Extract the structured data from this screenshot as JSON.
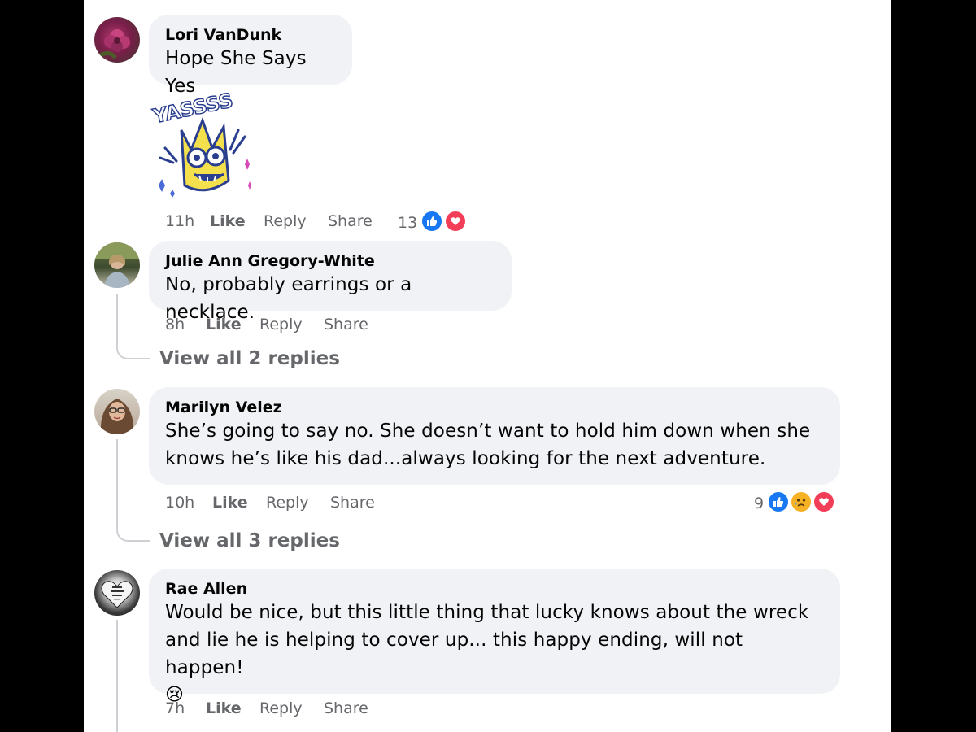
{
  "comments": [
    {
      "author": "Lori VanDunk",
      "text_lines": [
        "Hope She Says Yes"
      ],
      "sticker_text": "YASSSS",
      "time": "11h",
      "like": "Like",
      "reply": "Reply",
      "share": "Share",
      "reaction_count": "13",
      "reactions": [
        "like-icon",
        "love-icon"
      ]
    },
    {
      "author": "Julie Ann Gregory-White",
      "text_lines": [
        "No, probably earrings or a necklace."
      ],
      "time": "8h",
      "like": "Like",
      "reply": "Reply",
      "share": "Share",
      "view_replies": "View all 2 replies"
    },
    {
      "author": "Marilyn Velez",
      "text_lines": [
        "She’s going to say no. She doesn’t want to hold him down when she",
        "knows he’s like his dad...always looking for the next adventure."
      ],
      "time": "10h",
      "like": "Like",
      "reply": "Reply",
      "share": "Share",
      "reaction_count": "9",
      "reactions": [
        "like-icon",
        "sad-icon",
        "love-icon"
      ],
      "view_replies": "View all 3 replies"
    },
    {
      "author": "Rae Allen",
      "text_lines": [
        "Would be nice, but this little thing that lucky knows about the wreck",
        "and lie he is helping to cover up... this happy ending, will not happen!"
      ],
      "emoji": "😢",
      "time": "7h",
      "like": "Like",
      "reply": "Reply",
      "share": "Share"
    }
  ],
  "colors": {
    "bubble": "#f0f2f5",
    "meta_text": "#65676b",
    "like_blue": "#1877f2",
    "love_red": "#f33e58",
    "sad_yellow": "#f7b125"
  }
}
